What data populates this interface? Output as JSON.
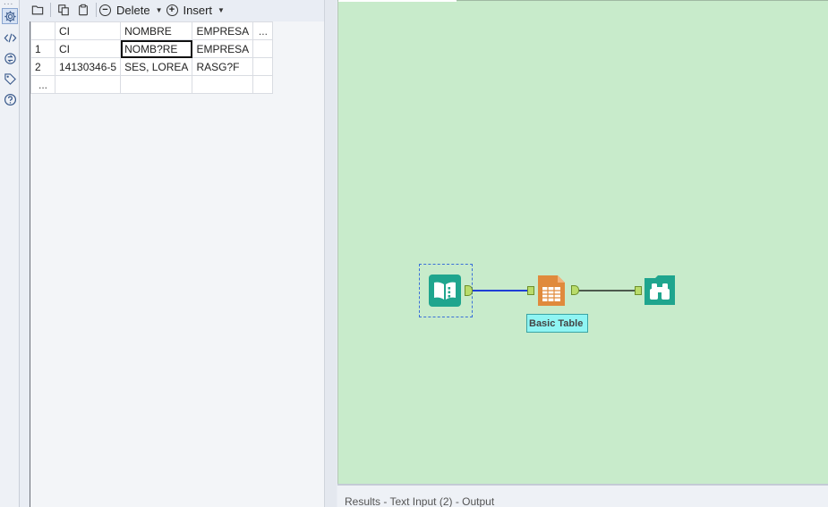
{
  "rail": {
    "dots": "...",
    "items": [
      {
        "icon": "gear-icon",
        "active": true
      },
      {
        "icon": "code-icon",
        "active": false
      },
      {
        "icon": "workflow-icon",
        "active": false
      },
      {
        "icon": "tag-icon",
        "active": false
      },
      {
        "icon": "help-icon",
        "active": false
      }
    ]
  },
  "toolbar": {
    "delete_label": "Delete",
    "insert_label": "Insert"
  },
  "grid": {
    "headers": [
      "",
      "CI",
      "NOMBRE",
      "EMPRESA",
      "..."
    ],
    "rows": [
      {
        "num": "1",
        "ci": "CI",
        "nombre": "NOMB?RE",
        "empresa": "EMPRESA",
        "extra": ""
      },
      {
        "num": "2",
        "ci": "14130346-5",
        "nombre": "SES, LOREA",
        "empresa": "RASG?F",
        "extra": ""
      },
      {
        "num": "...",
        "ci": "",
        "nombre": "",
        "empresa": "",
        "extra": ""
      }
    ]
  },
  "canvas": {
    "background": "#c8ebcb",
    "tool_label": "Basic Table"
  },
  "results": {
    "title": "Results - Text Input (2) - Output"
  },
  "colors": {
    "accent": "#3a6fd8",
    "tool_teal": "#1fa58e",
    "tool_orange": "#e08a3c",
    "label_bg": "#8ff5f3"
  }
}
